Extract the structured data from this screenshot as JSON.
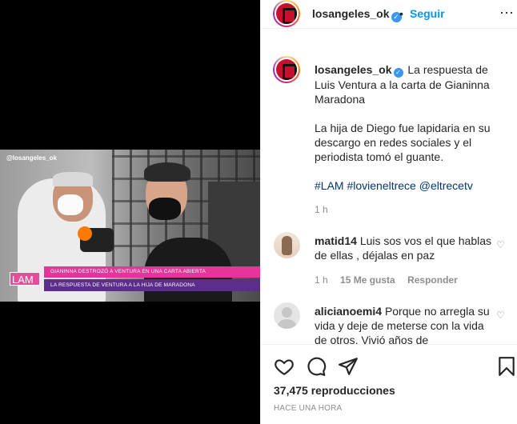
{
  "video": {
    "watermark": "@losangeles_ok",
    "logo": "LAM",
    "band_top": "GIANINNA DESTROZÓ A VENTURA EN UNA CARTA ABIERTA",
    "band_bottom": "LA RESPUESTA DE VENTURA A LA HIJA DE MARADONA"
  },
  "header": {
    "username": "losangeles_ok",
    "separator": "•",
    "follow_label": "Seguir",
    "more_icon": "more-icon"
  },
  "caption": {
    "username": "losangeles_ok",
    "text1": "La respuesta de Luis Ventura a la carta de Gianinna Maradona",
    "text2": "La hija de Diego fue lapidaria en su descargo en redes sociales y el periodista tomó el guante.",
    "tags": "#LAM #lovieneltrece @eltrecetv",
    "time": "1 h"
  },
  "comments": [
    {
      "username": "matid14",
      "text": "Luis sos vos el que hablas de ellas , déjalas en paz",
      "time": "1 h",
      "likes": "15 Me gusta",
      "reply": "Responder"
    },
    {
      "username": "alicianoemi4",
      "text": "Porque no arregla su vida y deje de meterse con la vida de otros. Vivió años de"
    }
  ],
  "actions": {
    "views_count": "37,475",
    "views_label": "reproducciones",
    "timestamp": "HACE UNA HORA"
  },
  "colors": {
    "link": "#0095f6",
    "tag": "#00376b",
    "muted": "#8e8e8e"
  }
}
